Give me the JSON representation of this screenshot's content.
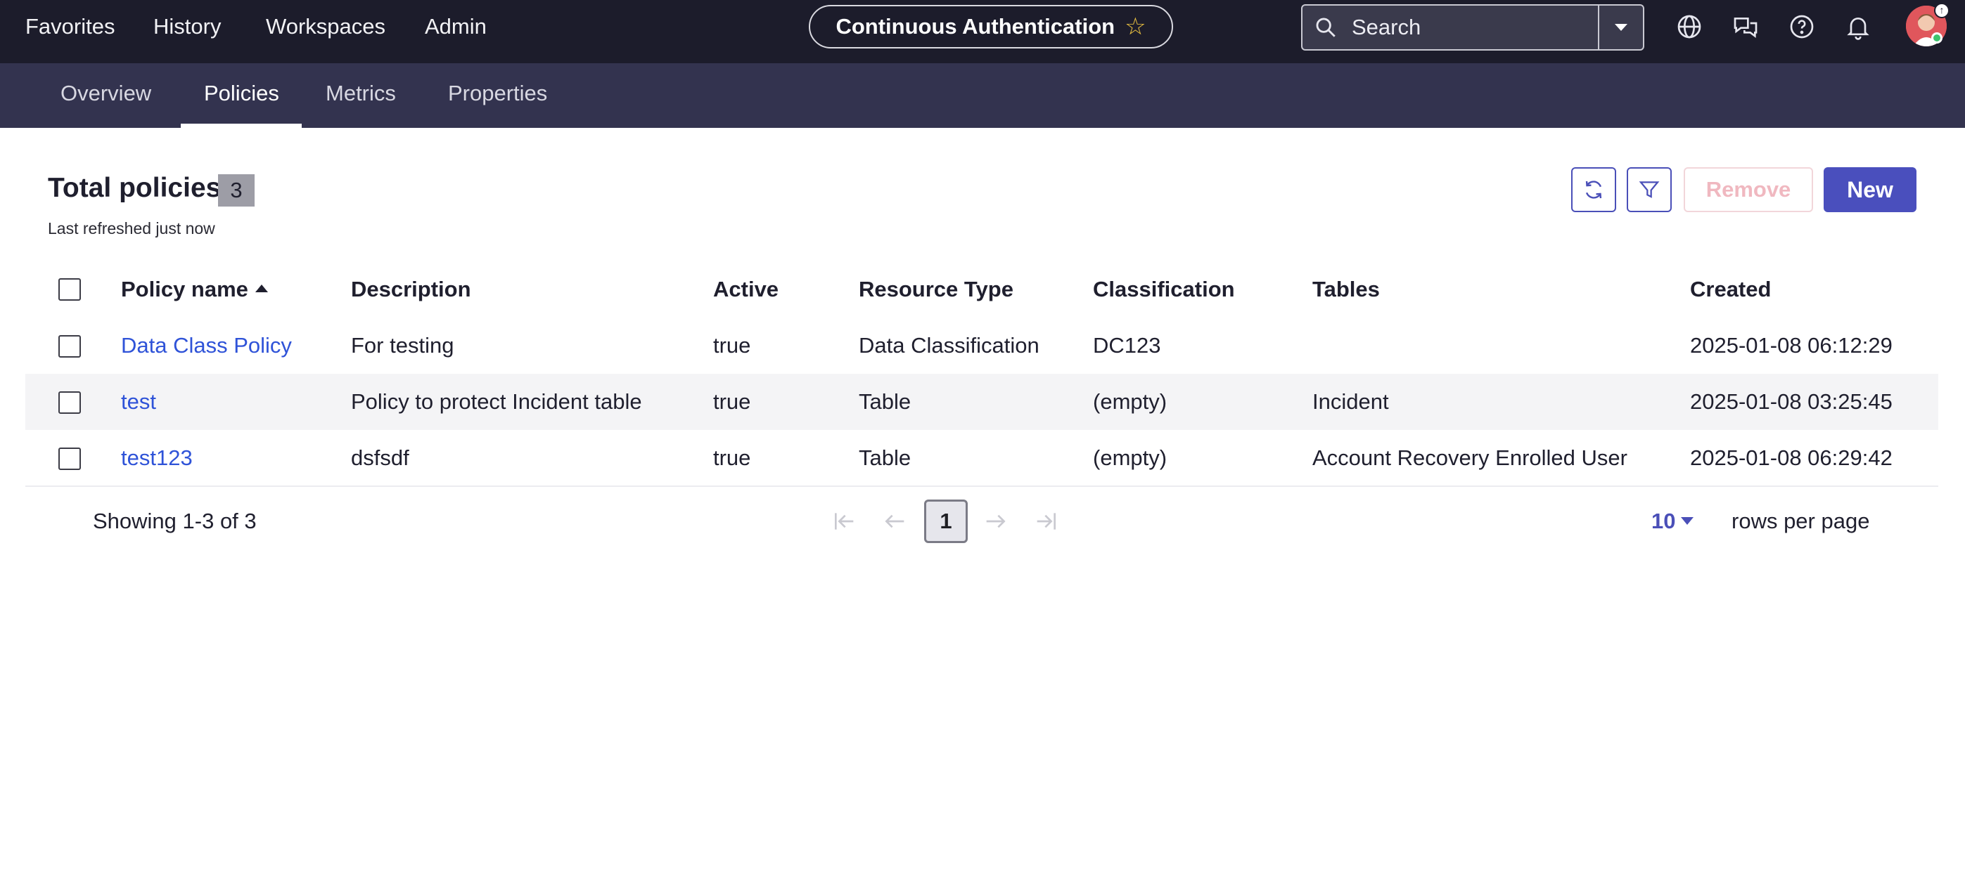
{
  "topnav": {
    "links": [
      "Favorites",
      "History",
      "Workspaces",
      "Admin"
    ],
    "context_title": "Continuous Authentication",
    "search_placeholder": "Search",
    "icons": [
      "globe-icon",
      "chat-icon",
      "help-icon",
      "bell-icon"
    ],
    "avatar_badge": "↑"
  },
  "tabs": [
    "Overview",
    "Policies",
    "Metrics",
    "Properties"
  ],
  "active_tab": "Policies",
  "header": {
    "title": "Total policies",
    "count": "3",
    "refreshed": "Last refreshed just now",
    "remove_label": "Remove",
    "new_label": "New"
  },
  "table": {
    "columns": [
      "Policy name",
      "Description",
      "Active",
      "Resource Type",
      "Classification",
      "Tables",
      "Created"
    ],
    "sorted_column": "Policy name",
    "rows": [
      {
        "name": "Data Class Policy",
        "description": "For testing",
        "active": "true",
        "resource_type": "Data Classification",
        "classification": "DC123",
        "tables": "",
        "created": "2025-01-08 06:12:29"
      },
      {
        "name": "test",
        "description": "Policy to protect Incident table",
        "active": "true",
        "resource_type": "Table",
        "classification": "(empty)",
        "tables": "Incident",
        "created": "2025-01-08 03:25:45"
      },
      {
        "name": "test123",
        "description": "dsfsdf",
        "active": "true",
        "resource_type": "Table",
        "classification": "(empty)",
        "tables": "Account Recovery Enrolled User",
        "created": "2025-01-08 06:29:42"
      }
    ]
  },
  "pagination": {
    "showing": "Showing 1-3 of 3",
    "current_page": "1",
    "rows_per_page": "10",
    "rows_per_page_label": "rows per page"
  },
  "colors": {
    "topbar": "#1c1c2b",
    "subbar": "#33334f",
    "accent": "#4a4fbd",
    "link": "#2f53d8"
  }
}
